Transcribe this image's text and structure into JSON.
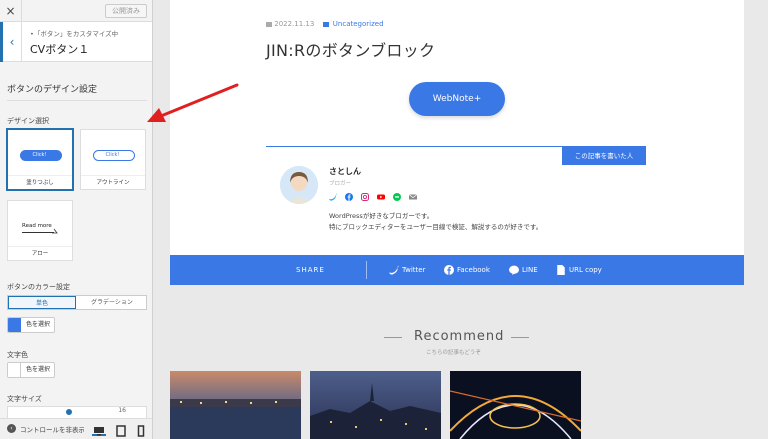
{
  "sidebar": {
    "close_icon": "×",
    "publish_label": "公開済み",
    "back_icon": "‹",
    "breadcrumb": "•「ボタン」をカスタマイズ中",
    "section_title": "CVボタン１",
    "design_heading": "ボタンのデザイン設定",
    "design_select_label": "デザイン選択",
    "designs": [
      {
        "preview_text": "Click！",
        "caption": "塗りつぶし",
        "selected": true
      },
      {
        "preview_text": "Click！",
        "caption": "アウトライン",
        "selected": false
      },
      {
        "preview_text": "Read more",
        "caption": "アロー",
        "selected": false
      }
    ],
    "color_setting_label": "ボタンのカラー設定",
    "color_mode_options": [
      "単色",
      "グラデーション"
    ],
    "color_mode_selected": "単色",
    "select_color_label": "色を選択",
    "button_color": "#3a78e6",
    "text_color_label": "文字色",
    "text_color": "#ffffff",
    "font_size_label": "文字サイズ",
    "font_size_value": "16",
    "hide_controls_label": "コントロールを非表示",
    "devices": [
      "desktop-icon",
      "tablet-icon",
      "mobile-icon"
    ],
    "active_device": "desktop-icon"
  },
  "post": {
    "date": "2022.11.13",
    "category": "Uncategorized",
    "title": "JIN:Rのボタンブロック",
    "cta_label": "WebNote+",
    "author_tag": "この記事を書いた人",
    "author_name": "さとしん",
    "author_role": "ブロガー",
    "author_bio_lines": [
      "WordPressが好きなブロガーです。",
      "特にブロックエディターをユーザー目線で検証、解説するのが好きです。"
    ],
    "sns_icons": [
      "twitter-icon",
      "facebook-icon",
      "instagram-icon",
      "youtube-icon",
      "line-icon",
      "mail-icon"
    ]
  },
  "share": {
    "label": "SHARE",
    "items": [
      {
        "label": "Twitter",
        "icon": "twitter-icon"
      },
      {
        "label": "Facebook",
        "icon": "facebook-icon"
      },
      {
        "label": "LINE",
        "icon": "line-icon"
      },
      {
        "label": "URL copy",
        "icon": "document-icon"
      }
    ]
  },
  "recommend": {
    "title": "Recommend",
    "subtitle": "こちらの記事もどうぞ"
  },
  "colors": {
    "accent": "#3a78e6",
    "wp_blue": "#2271b1",
    "arrow_red": "#e02020"
  }
}
